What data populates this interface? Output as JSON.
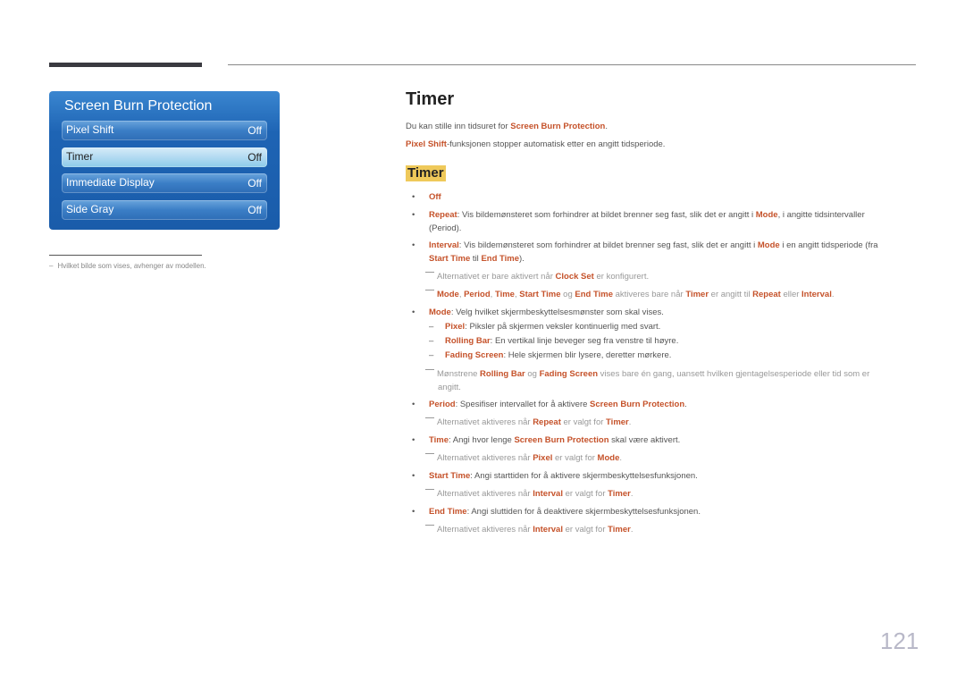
{
  "osd": {
    "title": "Screen Burn Protection",
    "items": [
      {
        "label": "Pixel Shift",
        "value": "Off",
        "selected": false
      },
      {
        "label": "Timer",
        "value": "Off",
        "selected": true
      },
      {
        "label": "Immediate Display",
        "value": "Off",
        "selected": false
      },
      {
        "label": "Side Gray",
        "value": "Off",
        "selected": false
      }
    ]
  },
  "footnote": {
    "dash": "–",
    "text": "Hvilket bilde som vises, avhenger av modellen."
  },
  "content": {
    "title": "Timer",
    "intro1": {
      "pre": "Du kan stille inn tidsuret for ",
      "hl": "Screen Burn Protection",
      "post": "."
    },
    "intro2": {
      "hl": "Pixel Shift",
      "post": "-funksjonen stopper automatisk etter en angitt tidsperiode."
    },
    "subtitle": "Timer",
    "off": "Off",
    "repeat": {
      "hl": "Repeat",
      "a": ": Vis bildemønsteret som forhindrer at bildet brenner seg fast, slik det er angitt i ",
      "mode": "Mode",
      "b": ", i angitte tidsintervaller",
      "line2": "(Period)."
    },
    "interval": {
      "hl": "Interval",
      "a": ": Vis bildemønsteret som forhindrer at bildet brenner seg fast, slik det er angitt i ",
      "mode": "Mode",
      "b": " i en angitt tidsperiode (fra",
      "start": "Start Time",
      "til": " til ",
      "end": "End Time",
      "c": ")."
    },
    "note1": {
      "a": "Alternativet er bare aktivert når ",
      "hl": "Clock Set",
      "b": " er konfigurert."
    },
    "note2": {
      "mode": "Mode",
      "period": "Period",
      "time": "Time",
      "start": "Start Time",
      "og": " og ",
      "end": "End Time",
      "a": " aktiveres bare når ",
      "timer": "Timer",
      "b": " er angitt til ",
      "repeat": "Repeat",
      "eller": " eller ",
      "interval": "Interval",
      "c": ".",
      "sep": ", "
    },
    "mode": {
      "hl": "Mode",
      "text": ": Velg hvilket skjermbeskyttelsesmønster som skal vises."
    },
    "mode_subs": [
      {
        "dash": "–",
        "hl": "Pixel",
        "text": ": Piksler på skjermen veksler kontinuerlig med svart."
      },
      {
        "dash": "–",
        "hl": "Rolling Bar",
        "text": ": En vertikal linje beveger seg fra venstre til høyre."
      },
      {
        "dash": "–",
        "hl": "Fading Screen",
        "text": ": Hele skjermen blir lysere, deretter mørkere."
      }
    ],
    "note3": {
      "a": "Mønstrene ",
      "rb": "Rolling Bar",
      "og": " og ",
      "fs": "Fading Screen",
      "b": " vises bare én gang, uansett hvilken gjentagelsesperiode eller tid som er",
      "line2": "angitt."
    },
    "period": {
      "hl": "Period",
      "a": ": Spesifiser intervallet for å aktivere ",
      "sbp": "Screen Burn Protection",
      "b": "."
    },
    "note4": {
      "a": "Alternativet aktiveres når ",
      "hl": "Repeat",
      "b": " er valgt for ",
      "timer": "Timer",
      "c": "."
    },
    "time": {
      "hl": "Time",
      "a": ": Angi hvor lenge ",
      "sbp": "Screen Burn Protection",
      "b": " skal være aktivert."
    },
    "note5": {
      "a": "Alternativet aktiveres når ",
      "hl": "Pixel",
      "b": " er valgt for ",
      "mode": "Mode",
      "c": "."
    },
    "start": {
      "hl": "Start Time",
      "text": ": Angi starttiden for å aktivere skjermbeskyttelsesfunksjonen."
    },
    "note6": {
      "a": "Alternativet aktiveres når ",
      "hl": "Interval",
      "b": " er valgt for ",
      "timer": "Timer",
      "c": "."
    },
    "end": {
      "hl": "End Time",
      "text": ": Angi sluttiden for å deaktivere skjermbeskyttelsesfunksjonen."
    },
    "note7": {
      "a": "Alternativet aktiveres når ",
      "hl": "Interval",
      "b": " er valgt for ",
      "timer": "Timer",
      "c": "."
    },
    "bullet": "•"
  },
  "page_number": "121",
  "colors": {
    "highlight": "#c5522a",
    "subtitle_bg": "#efc95a",
    "osd_blue": "#1e64b4"
  }
}
